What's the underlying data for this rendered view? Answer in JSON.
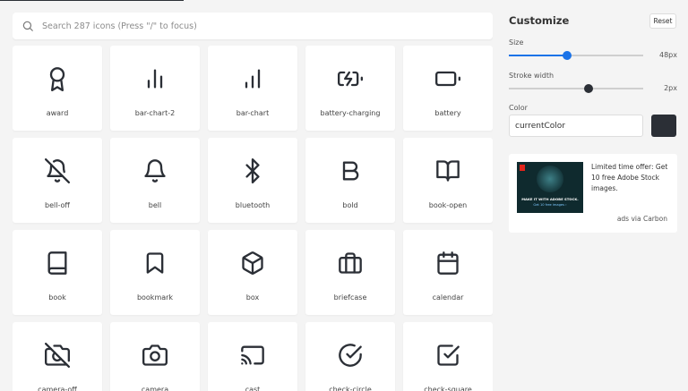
{
  "search": {
    "placeholder": "Search 287 icons (Press \"/\" to focus)"
  },
  "icons": [
    {
      "name": "award",
      "icon": "award-icon"
    },
    {
      "name": "bar-chart-2",
      "icon": "bar-chart-2-icon"
    },
    {
      "name": "bar-chart",
      "icon": "bar-chart-icon"
    },
    {
      "name": "battery-charging",
      "icon": "battery-charging-icon"
    },
    {
      "name": "battery",
      "icon": "battery-icon"
    },
    {
      "name": "bell-off",
      "icon": "bell-off-icon"
    },
    {
      "name": "bell",
      "icon": "bell-icon"
    },
    {
      "name": "bluetooth",
      "icon": "bluetooth-icon"
    },
    {
      "name": "bold",
      "icon": "bold-icon"
    },
    {
      "name": "book-open",
      "icon": "book-open-icon"
    },
    {
      "name": "book",
      "icon": "book-icon"
    },
    {
      "name": "bookmark",
      "icon": "bookmark-icon"
    },
    {
      "name": "box",
      "icon": "box-icon"
    },
    {
      "name": "briefcase",
      "icon": "briefcase-icon"
    },
    {
      "name": "calendar",
      "icon": "calendar-icon"
    },
    {
      "name": "camera-off",
      "icon": "camera-off-icon"
    },
    {
      "name": "camera",
      "icon": "camera-icon"
    },
    {
      "name": "cast",
      "icon": "cast-icon"
    },
    {
      "name": "check-circle",
      "icon": "check-circle-icon"
    },
    {
      "name": "check-square",
      "icon": "check-square-icon"
    }
  ],
  "customize": {
    "title": "Customize",
    "reset_label": "Reset",
    "size": {
      "label": "Size",
      "value_text": "48px",
      "fraction": 0.43
    },
    "stroke": {
      "label": "Stroke width",
      "value_text": "2px",
      "fraction": 0.59
    },
    "color": {
      "label": "Color",
      "value": "currentColor",
      "swatch": "#2b2f36"
    },
    "accent": "#1a73e8"
  },
  "ad": {
    "image_line1": "MAKE IT WITH ADOBE STOCK.",
    "image_line2": "Get 10 free images ›",
    "text": "Limited time offer: Get 10 free Adobe Stock images.",
    "via": "ads via Carbon"
  }
}
